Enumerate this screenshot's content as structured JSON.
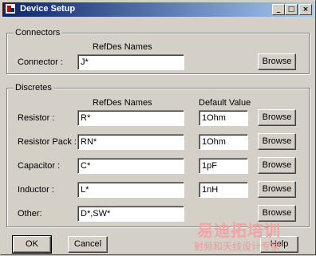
{
  "window": {
    "title": "Device Setup"
  },
  "titlebar_buttons": {
    "minimize": "_",
    "maximize": "□",
    "close": "×"
  },
  "connectors": {
    "group_title": "Connectors",
    "col_refdes": "RefDes Names",
    "rows": [
      {
        "label": "Connector :",
        "refdes": "J*",
        "browse": "Browse"
      }
    ]
  },
  "discretes": {
    "group_title": "Discretes",
    "col_refdes": "RefDes Names",
    "col_default": "Default Value",
    "rows": [
      {
        "label": "Resistor :",
        "refdes": "R*",
        "default": "1Ohm",
        "browse": "Browse"
      },
      {
        "label": "Resistor Pack :",
        "refdes": "RN*",
        "default": "1Ohm",
        "browse": "Browse"
      },
      {
        "label": "Capacitor :",
        "refdes": "C*",
        "default": "1pF",
        "browse": "Browse"
      },
      {
        "label": "Inductor :",
        "refdes": "L*",
        "default": "1nH",
        "browse": "Browse"
      },
      {
        "label": "Other:",
        "refdes": "D*,SW*",
        "browse": "Browse"
      }
    ]
  },
  "footer": {
    "ok": "OK",
    "cancel": "Cancel",
    "help": "Help"
  },
  "watermark": {
    "line1": "易迪拓培训",
    "line2": "射频和天线设计专家"
  }
}
